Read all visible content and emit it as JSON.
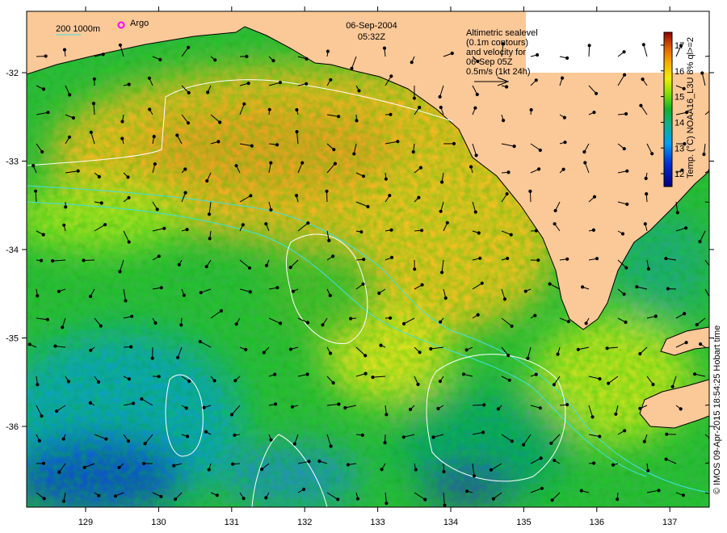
{
  "header": {
    "date": "06-Sep-2004",
    "time": "05:32Z"
  },
  "legend": {
    "depth_contours": "200  1000m",
    "argo": "Argo",
    "argo_color": "#ff00ff",
    "altimetry_lines": [
      "Altimetric sealevel",
      "(0.1m contours)",
      "and velocity for",
      "06-Sep 05Z",
      "0.5m/s (1kt 24h)"
    ]
  },
  "colorbar": {
    "label": "Temp. (°C) NOAA16_L3U 8% ql>=2",
    "ticks": [
      "12",
      "13",
      "14",
      "15",
      "16",
      "17"
    ],
    "range": [
      11.5,
      17.5
    ]
  },
  "axes": {
    "lon_ticks": [
      "129",
      "130",
      "131",
      "132",
      "133",
      "134",
      "135",
      "136",
      "137"
    ],
    "lat_ticks": [
      "-32",
      "-33",
      "-34",
      "-35",
      "-36"
    ]
  },
  "credit": "© IMOS 09-Apr-2015 18:54:25 Hobart time",
  "colors": {
    "land": "#fbc898",
    "contour": "#ffffff",
    "isobath": "#40e0e0"
  }
}
